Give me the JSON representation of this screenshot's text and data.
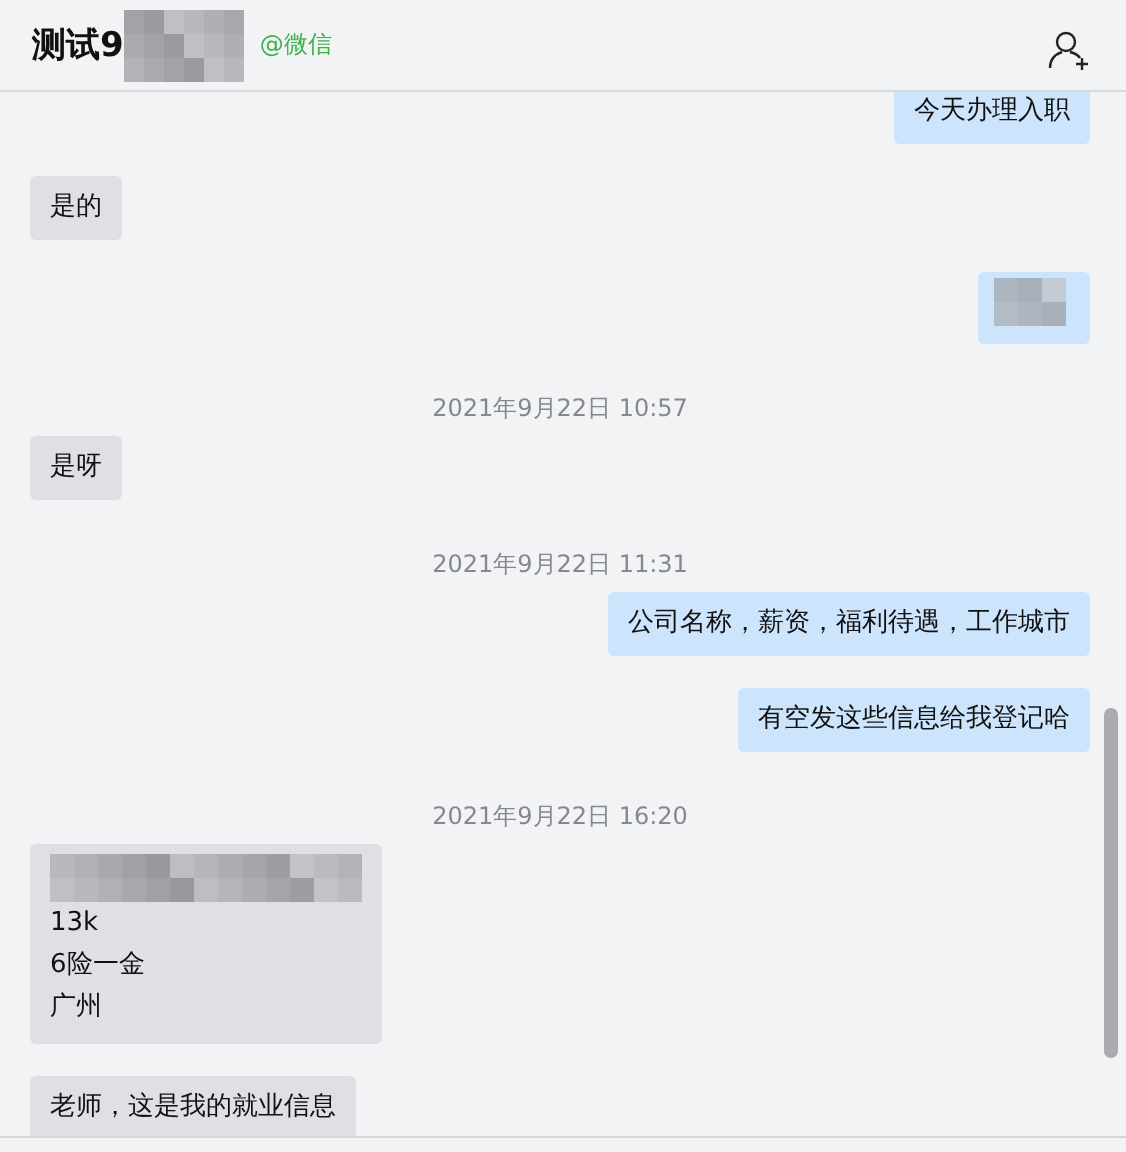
{
  "header": {
    "title": "测试9",
    "source": "@微信"
  },
  "messages": [
    {
      "kind": "out",
      "text": "今天办理入职"
    },
    {
      "kind": "in",
      "text": "是的"
    },
    {
      "kind": "redacted_out"
    },
    {
      "kind": "time",
      "text": "2021年9月22日 10:57"
    },
    {
      "kind": "in",
      "text": "是呀"
    },
    {
      "kind": "time",
      "text": "2021年9月22日 11:31"
    },
    {
      "kind": "out",
      "text": "公司名称，薪资，福利待遇，工作城市"
    },
    {
      "kind": "out",
      "text": "有空发这些信息给我登记哈"
    },
    {
      "kind": "time",
      "text": "2021年9月22日 16:20"
    },
    {
      "kind": "card",
      "lines": [
        "13k",
        "6险一金",
        "广州"
      ]
    },
    {
      "kind": "in",
      "text": "老师，这是我的就业信息"
    }
  ]
}
